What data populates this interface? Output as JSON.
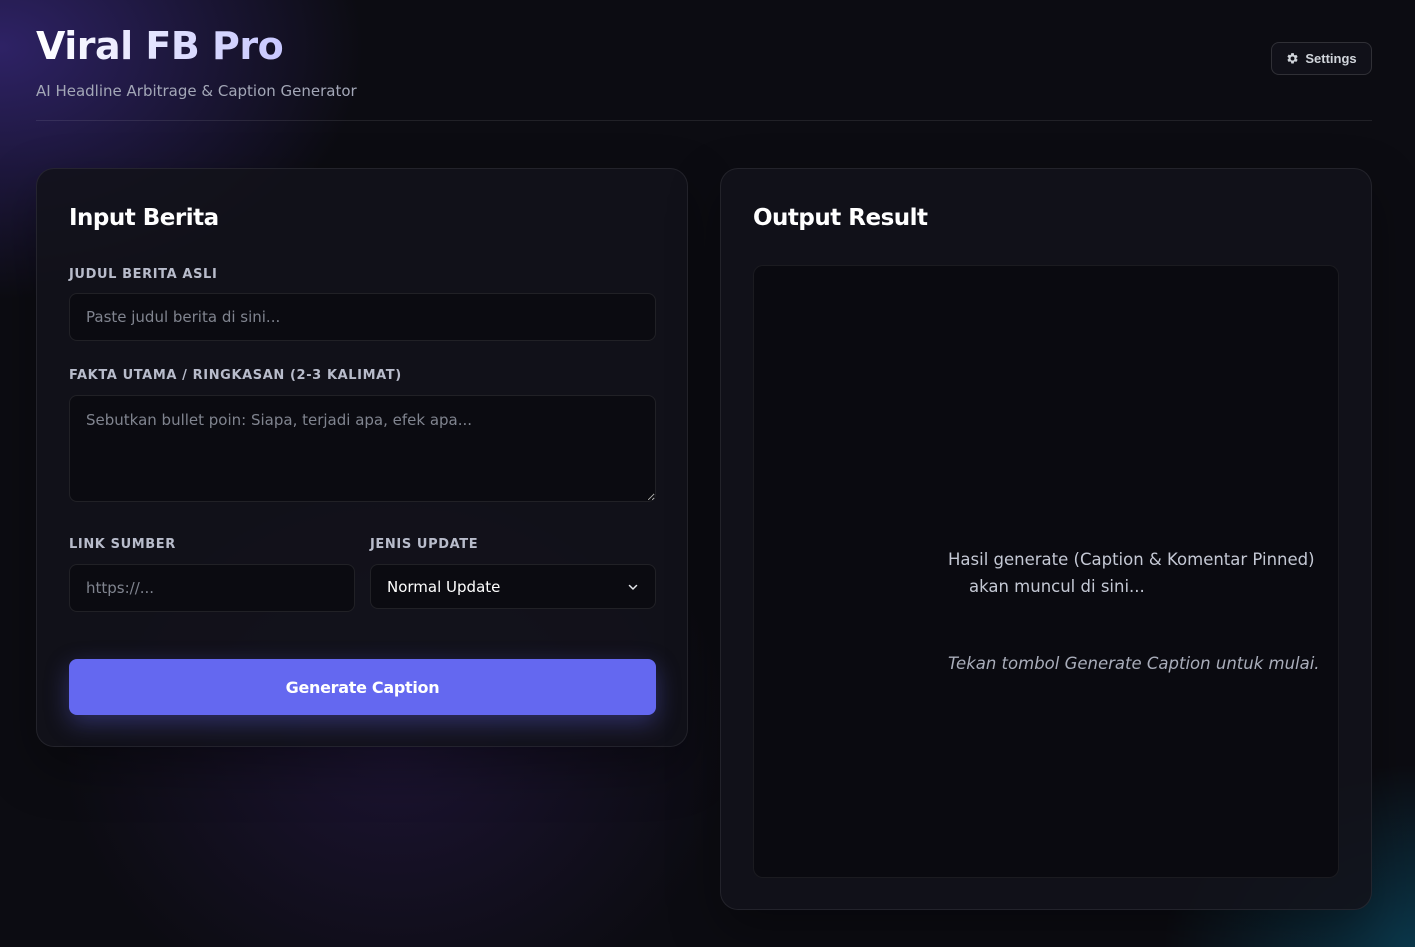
{
  "header": {
    "title": "Viral FB Pro",
    "subtitle": "AI Headline Arbitrage & Caption Generator",
    "settings_label": "Settings"
  },
  "input_card": {
    "title": "Input Berita",
    "headline_label": "JUDUL BERITA ASLI",
    "headline_placeholder": "Paste judul berita di sini...",
    "facts_label": "FAKTA UTAMA / RINGKASAN (2-3 KALIMAT)",
    "facts_placeholder": "Sebutkan bullet poin: Siapa, terjadi apa, efek apa...",
    "link_label": "LINK SUMBER",
    "link_placeholder": "https://...",
    "update_label": "JENIS UPDATE",
    "update_value": "Normal Update",
    "generate_label": "Generate Caption"
  },
  "output_card": {
    "title": "Output Result",
    "placeholder_text": "Hasil generate (Caption & Komentar Pinned)\n    akan muncul di sini...",
    "hint_text": "Tekan tombol Generate Caption untuk mulai."
  },
  "icons": {
    "settings": "gear-icon",
    "select": "chevron-down-icon"
  },
  "colors": {
    "accent": "#6468f0",
    "background": "#0c0c12",
    "card": "#12121a"
  }
}
